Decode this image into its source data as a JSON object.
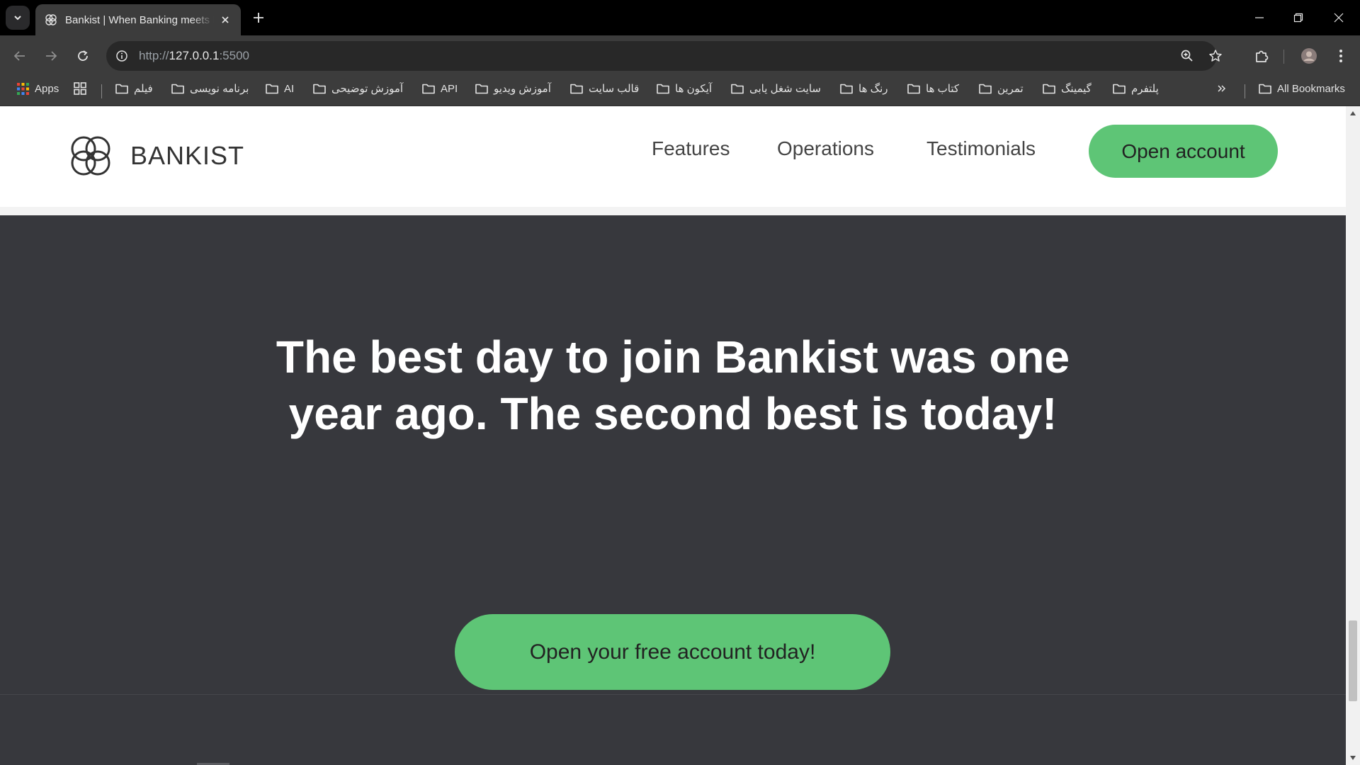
{
  "browser": {
    "tab_title": "Bankist | When Banking meets Minimalist",
    "url_scheme": "http://",
    "url_host": "127.0.0.1",
    "url_port": ":5500",
    "bookmarks": [
      {
        "label": "Apps",
        "icon": "apps-grid-icon"
      },
      {
        "label": "",
        "icon": "tab-groups-icon"
      },
      {
        "label": "فیلم",
        "icon": "folder-icon"
      },
      {
        "label": "برنامه نویسی",
        "icon": "folder-icon"
      },
      {
        "label": "AI",
        "icon": "folder-icon"
      },
      {
        "label": "آموزش توضیحی",
        "icon": "folder-icon"
      },
      {
        "label": "API",
        "icon": "folder-icon"
      },
      {
        "label": "آموزش ویدیو",
        "icon": "folder-icon"
      },
      {
        "label": "قالب سایت",
        "icon": "folder-icon"
      },
      {
        "label": "آیکون ها",
        "icon": "folder-icon"
      },
      {
        "label": "سایت شغل یابی",
        "icon": "folder-icon"
      },
      {
        "label": "رنگ ها",
        "icon": "folder-icon"
      },
      {
        "label": "کتاب ها",
        "icon": "folder-icon"
      },
      {
        "label": "تمرین",
        "icon": "folder-icon"
      },
      {
        "label": "گیمینگ",
        "icon": "folder-icon"
      },
      {
        "label": "پلتفرم",
        "icon": "folder-icon"
      }
    ],
    "all_bookmarks": "All Bookmarks"
  },
  "site": {
    "logo_text": "BANKIST",
    "nav": [
      "Features",
      "Operations",
      "Testimonials"
    ],
    "open_account": "Open account",
    "signup_title_line1": "The best day to join Bankist was one",
    "signup_title_line2": "year ago. The second best is today!",
    "cta": "Open your free account today!"
  },
  "colors": {
    "accent_green": "#5ec576",
    "section_bg": "#37383d",
    "chrome_bg": "#3c3c3c"
  }
}
